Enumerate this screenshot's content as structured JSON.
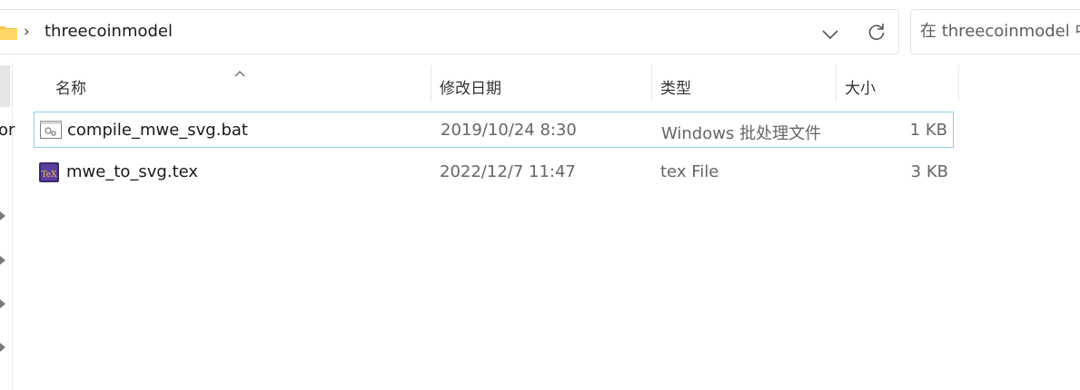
{
  "address": {
    "crumbs": [
      "threecoinmodel"
    ],
    "search_placeholder": "在 threecoinmodel 中"
  },
  "nav": {
    "fragment": "or"
  },
  "columns": {
    "name": "名称",
    "date": "修改日期",
    "type": "类型",
    "size": "大小"
  },
  "files": [
    {
      "name": "compile_mwe_svg.bat",
      "date": "2019/10/24 8:30",
      "type": "Windows 批处理文件",
      "size": "1 KB",
      "icon": "batch-file-icon",
      "selected": true
    },
    {
      "name": "mwe_to_svg.tex",
      "date": "2022/12/7 11:47",
      "type": "tex File",
      "size": "3 KB",
      "icon": "tex-file-icon",
      "selected": false
    }
  ]
}
